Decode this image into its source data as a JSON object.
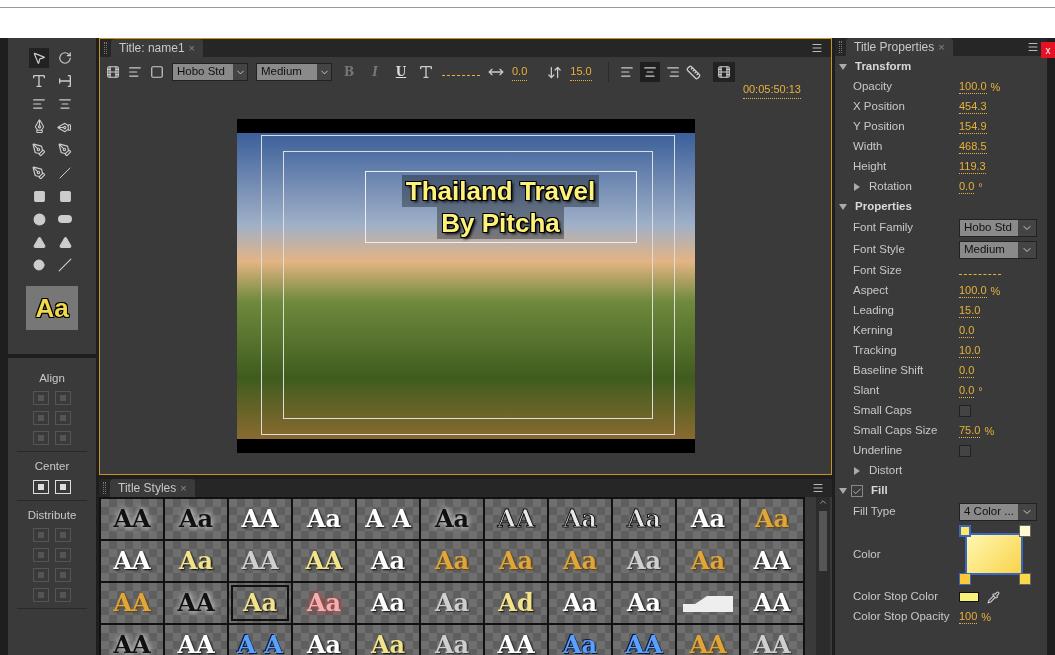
{
  "window": {
    "close": "x"
  },
  "tools_panel": {
    "style_preview": "Aa"
  },
  "align_panel": {
    "sections": [
      {
        "label": "Align",
        "enabled": false
      },
      {
        "label": "Center",
        "enabled": true
      },
      {
        "label": "Distribute",
        "enabled": false
      }
    ]
  },
  "title_panel": {
    "tab": "Title: name1",
    "close": "×",
    "font_family": "Hobo Std",
    "font_style": "Medium",
    "format_buttons": [
      {
        "label": "B",
        "disabled": true
      },
      {
        "label": "I",
        "disabled": true
      },
      {
        "label": "U",
        "disabled": false
      }
    ],
    "kerning": "0.0",
    "leading": "15.0",
    "align_buttons": [
      {
        "selected": false
      },
      {
        "selected": true
      },
      {
        "selected": false
      }
    ],
    "timecode": "00:05:50:13",
    "canvas": {
      "title_lines": [
        "Thailand Travel",
        "By Pitcha"
      ]
    }
  },
  "styles_panel": {
    "tab": "Title Styles",
    "close": "×",
    "swatches": [
      {
        "sample": "AA",
        "kind": "black",
        "selected": false
      },
      {
        "sample": "Aa",
        "kind": "black",
        "selected": false
      },
      {
        "sample": "AA",
        "kind": "white",
        "selected": false
      },
      {
        "sample": "Aa",
        "kind": "white",
        "selected": false
      },
      {
        "sample": "A A",
        "kind": "white",
        "selected": false
      },
      {
        "sample": "Aa",
        "kind": "black",
        "selected": false
      },
      {
        "sample": "AA",
        "kind": "outline",
        "selected": false
      },
      {
        "sample": "Aa",
        "kind": "outline",
        "selected": false
      },
      {
        "sample": "Aa",
        "kind": "outline",
        "selected": false
      },
      {
        "sample": "Aa",
        "kind": "white",
        "selected": false
      },
      {
        "sample": "Aa",
        "kind": "gold",
        "selected": false
      },
      {
        "sample": "AA",
        "kind": "white",
        "selected": false
      },
      {
        "sample": "Aa",
        "kind": "yellow",
        "selected": false
      },
      {
        "sample": "AA",
        "kind": "silver",
        "selected": false
      },
      {
        "sample": "AA",
        "kind": "yellow",
        "selected": false
      },
      {
        "sample": "Aa",
        "kind": "white",
        "selected": false
      },
      {
        "sample": "Aa",
        "kind": "gold",
        "selected": false
      },
      {
        "sample": "Aa",
        "kind": "gold",
        "selected": false
      },
      {
        "sample": "Aa",
        "kind": "gold",
        "selected": false
      },
      {
        "sample": "Aa",
        "kind": "silver",
        "selected": false
      },
      {
        "sample": "Aa",
        "kind": "gold",
        "selected": false
      },
      {
        "sample": "AA",
        "kind": "white",
        "selected": false
      },
      {
        "sample": "AA",
        "kind": "gold",
        "selected": false
      },
      {
        "sample": "AA",
        "kind": "black",
        "selected": false
      },
      {
        "sample": "Aa",
        "kind": "yellow",
        "selected": true
      },
      {
        "sample": "Aa",
        "kind": "red",
        "selected": false
      },
      {
        "sample": "Aa",
        "kind": "white",
        "selected": false
      },
      {
        "sample": "Aa",
        "kind": "silver",
        "selected": false
      },
      {
        "sample": "Ad",
        "kind": "yellow",
        "selected": false
      },
      {
        "sample": "Aa",
        "kind": "white",
        "selected": false
      },
      {
        "sample": "Aa",
        "kind": "white",
        "selected": false
      },
      {
        "kind": "graphic",
        "selected": false
      },
      {
        "sample": "AA",
        "kind": "white",
        "selected": false
      },
      {
        "sample": "AA",
        "kind": "black",
        "selected": false
      },
      {
        "sample": "AA",
        "kind": "white",
        "selected": false
      },
      {
        "sample": "A A",
        "kind": "blue",
        "selected": false
      },
      {
        "sample": "Aa",
        "kind": "white",
        "selected": false
      },
      {
        "sample": "Aa",
        "kind": "yellow",
        "selected": false
      },
      {
        "sample": "Aa",
        "kind": "silver",
        "selected": false
      },
      {
        "sample": "AA",
        "kind": "white",
        "selected": false
      },
      {
        "sample": "Aa",
        "kind": "blue",
        "selected": false
      },
      {
        "sample": "AA",
        "kind": "blue",
        "selected": false
      },
      {
        "sample": "AA",
        "kind": "gold",
        "selected": false
      },
      {
        "sample": "AA",
        "kind": "silver",
        "selected": false
      }
    ]
  },
  "properties_panel": {
    "tab": "Title Properties",
    "close": "×",
    "rows": [
      {
        "kind": "section",
        "label": "Transform",
        "expanded": true
      },
      {
        "kind": "value",
        "label": "Opacity",
        "value": "100.0",
        "unit": "%"
      },
      {
        "kind": "value",
        "label": "X Position",
        "value": "454.3"
      },
      {
        "kind": "value",
        "label": "Y Position",
        "value": "154.9"
      },
      {
        "kind": "value",
        "label": "Width",
        "value": "468.5"
      },
      {
        "kind": "value",
        "label": "Height",
        "value": "119.3"
      },
      {
        "kind": "group",
        "label": "Rotation",
        "expanded": false,
        "value": "0.0",
        "unit": "°"
      },
      {
        "kind": "section",
        "label": "Properties",
        "expanded": true
      },
      {
        "kind": "dropdown",
        "label": "Font Family",
        "value": "Hobo Std"
      },
      {
        "kind": "dropdown",
        "label": "Font Style",
        "value": "Medium"
      },
      {
        "kind": "blank",
        "label": "Font Size"
      },
      {
        "kind": "value",
        "label": "Aspect",
        "value": "100.0",
        "unit": "%"
      },
      {
        "kind": "value",
        "label": "Leading",
        "value": "15.0"
      },
      {
        "kind": "value",
        "label": "Kerning",
        "value": "0.0"
      },
      {
        "kind": "value",
        "label": "Tracking",
        "value": "10.0"
      },
      {
        "kind": "value",
        "label": "Baseline Shift",
        "value": "0.0"
      },
      {
        "kind": "value",
        "label": "Slant",
        "value": "0.0",
        "unit": "°"
      },
      {
        "kind": "checkbox",
        "label": "Small Caps",
        "checked": false
      },
      {
        "kind": "value",
        "label": "Small Caps Size",
        "value": "75.0",
        "unit": "%"
      },
      {
        "kind": "checkbox",
        "label": "Underline",
        "checked": false
      },
      {
        "kind": "group",
        "label": "Distort",
        "expanded": false
      },
      {
        "kind": "section",
        "label": "Fill",
        "expanded": true,
        "checked": true
      },
      {
        "kind": "dropdown",
        "label": "Fill Type",
        "value": "4 Color ..."
      },
      {
        "kind": "gradient",
        "label": "Color"
      },
      {
        "kind": "swatch",
        "label": "Color Stop Color",
        "color": "#f8f27a"
      },
      {
        "kind": "value",
        "label": "Color Stop Opacity",
        "value": "100",
        "unit": "%"
      }
    ]
  }
}
